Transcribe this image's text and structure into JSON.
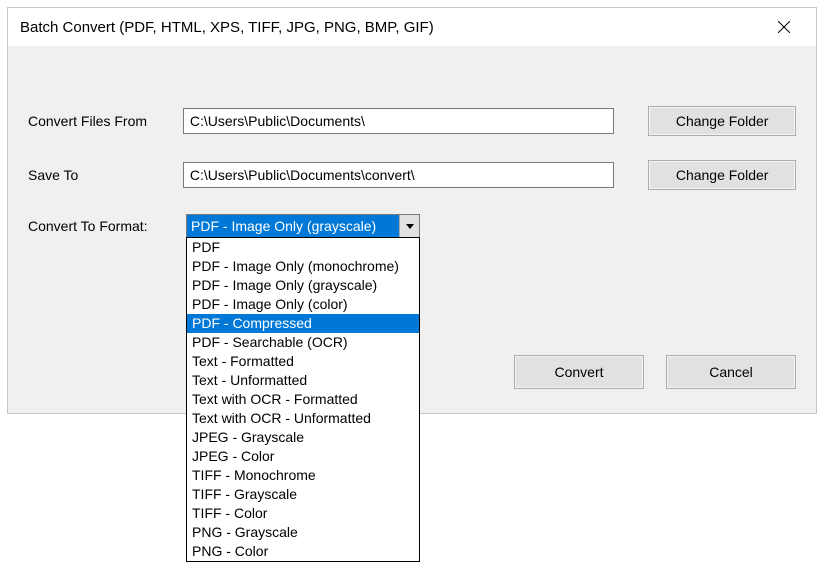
{
  "window": {
    "title": "Batch Convert (PDF, HTML, XPS, TIFF, JPG, PNG, BMP, GIF)"
  },
  "labels": {
    "convert_from": "Convert Files From",
    "save_to": "Save To",
    "convert_to_format": "Convert To Format:"
  },
  "fields": {
    "convert_from_value": "C:\\Users\\Public\\Documents\\",
    "save_to_value": "C:\\Users\\Public\\Documents\\convert\\"
  },
  "buttons": {
    "change_folder": "Change Folder",
    "convert": "Convert",
    "cancel": "Cancel"
  },
  "format": {
    "selected_display": "PDF - Image Only (grayscale)",
    "highlighted_index": 4,
    "options": [
      "PDF",
      "PDF - Image Only (monochrome)",
      "PDF - Image Only (grayscale)",
      "PDF - Image Only (color)",
      "PDF - Compressed",
      "PDF - Searchable (OCR)",
      "Text - Formatted",
      "Text - Unformatted",
      "Text with OCR - Formatted",
      "Text with OCR - Unformatted",
      "JPEG - Grayscale",
      "JPEG - Color",
      "TIFF - Monochrome",
      "TIFF - Grayscale",
      "TIFF - Color",
      "PNG - Grayscale",
      "PNG - Color"
    ]
  }
}
